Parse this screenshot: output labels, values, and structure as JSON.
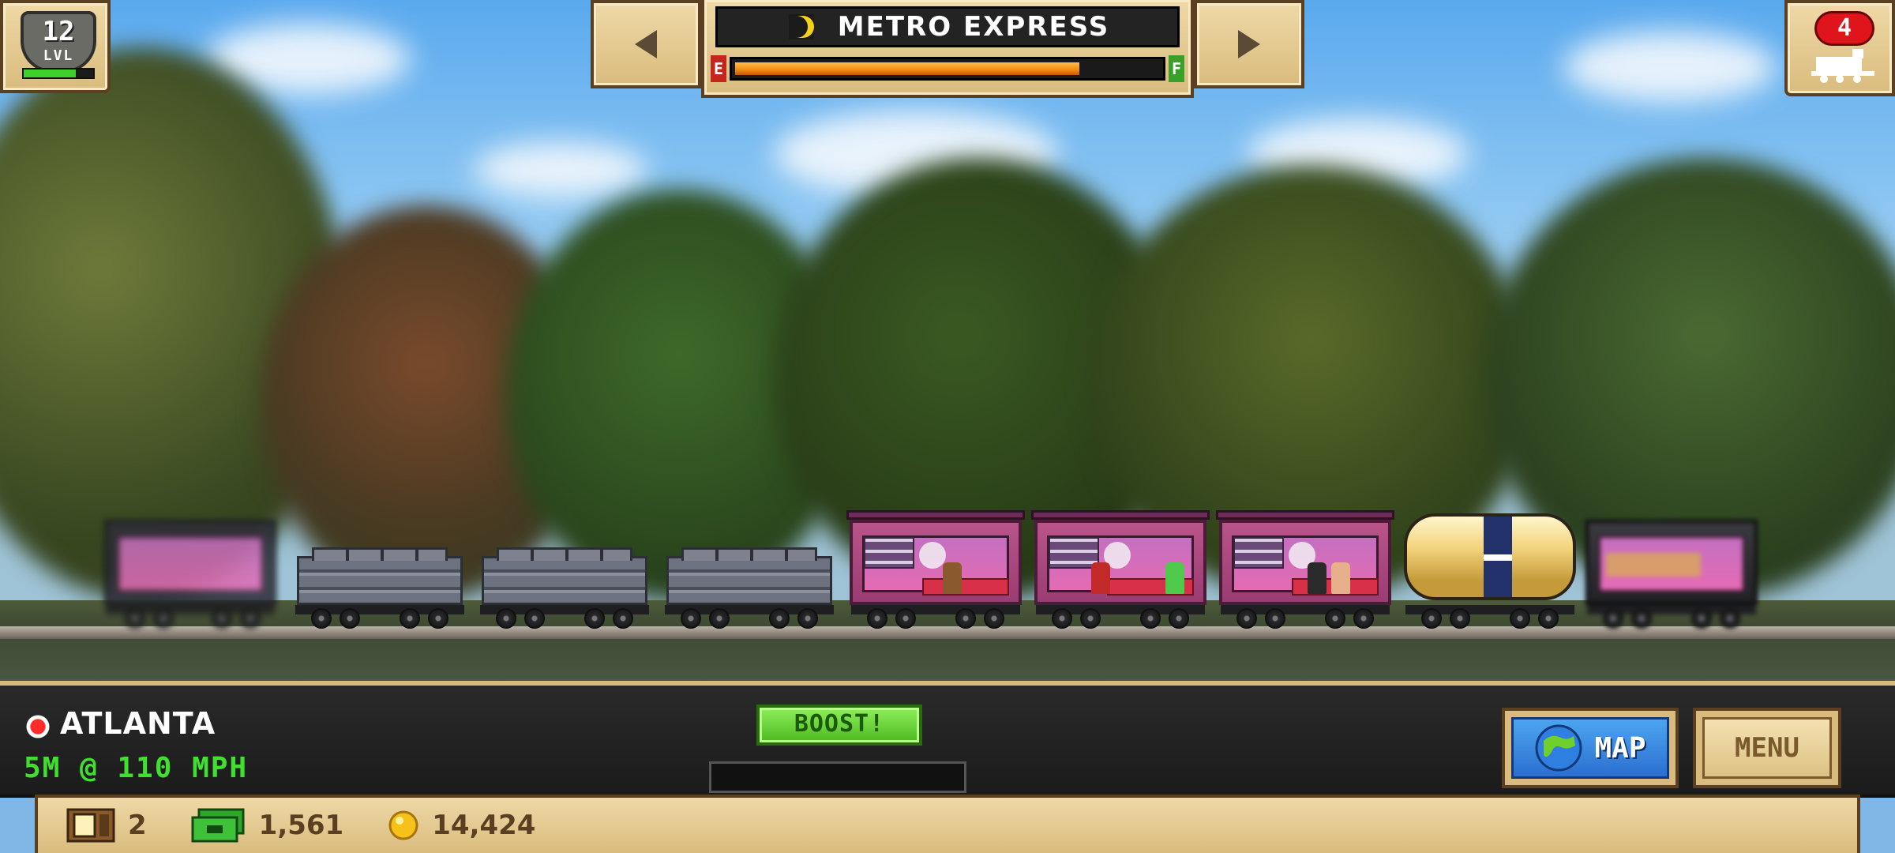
{
  "hud_top": {
    "level": "12",
    "level_label": "LVL",
    "level_progress": 0.75,
    "train_name": "METRO EXPRESS",
    "fuel_empty_label": "E",
    "fuel_full_label": "F",
    "fuel_level": 0.81,
    "trains_count": "4"
  },
  "hud_bottom": {
    "station": "ATLANTA",
    "distance_speed": "5M @ 110 MPH",
    "boost_label": "BOOST!",
    "boost_progress": 0,
    "map_label": "MAP",
    "menu_label": "MENU"
  },
  "resources": {
    "crates": "2",
    "cash": "1,561",
    "coins": "14,424"
  },
  "colors": {
    "fuel_fill": "#f08a10",
    "boost_green": "#4cb820",
    "level_fill": "#3fd02c",
    "alert_red": "#e0141b"
  },
  "icons": {
    "prev": "left-arrow-icon",
    "next": "right-arrow-icon",
    "train_type": "half-moon-icon",
    "trains": "locomotive-icon",
    "station": "station-marker-icon",
    "map": "globe-icon",
    "crate": "crate-icon",
    "cash": "cash-icon",
    "coin": "coin-icon"
  }
}
